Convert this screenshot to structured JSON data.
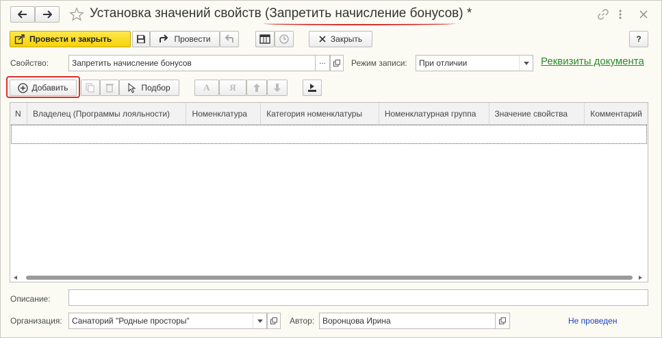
{
  "window": {
    "title": "Установка значений свойств (Запретить начисление бонусов) *"
  },
  "toolbar": {
    "post_and_close": "Провести и закрыть",
    "post": "Провести",
    "close": "Закрыть",
    "help": "?"
  },
  "property": {
    "label": "Свойство:",
    "value": "Запретить начисление бонусов",
    "ellipsis": "..."
  },
  "record_mode": {
    "label": "Режим записи:",
    "value": "При отличии"
  },
  "doc_details_link": "Реквизиты документа",
  "table_toolbar": {
    "add": "Добавить",
    "pick": "Подбор",
    "sort_asc": "А",
    "sort_desc": "Я"
  },
  "table": {
    "columns": [
      "N",
      "Владелец (Программы лояльности)",
      "Номенклатура",
      "Категория номенклатуры",
      "Номенклатурная группа",
      "Значение свойства",
      "Комментарий"
    ]
  },
  "description": {
    "label": "Описание:",
    "value": ""
  },
  "organization": {
    "label": "Организация:",
    "value": "Санаторий \"Родные просторы\""
  },
  "author": {
    "label": "Автор:",
    "value": "Воронцова Ирина"
  },
  "status": "Не проведен",
  "colors": {
    "accent_yellow": "#f5d20c",
    "link_green": "#2a8a2a",
    "status_blue": "#1a3fc0",
    "highlight_red": "#d83030"
  }
}
